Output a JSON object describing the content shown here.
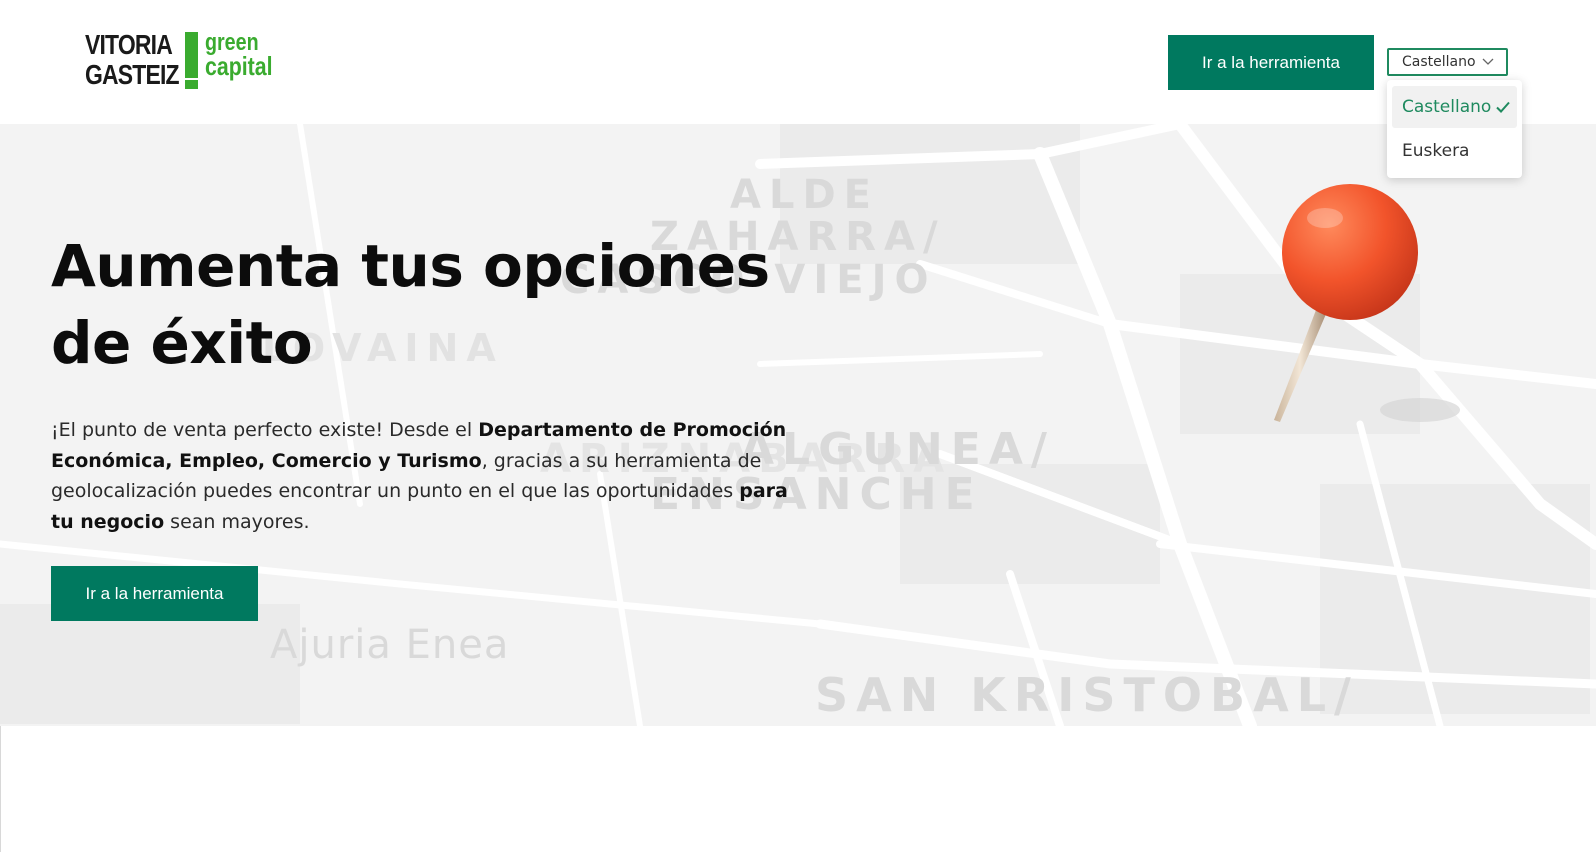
{
  "header": {
    "logo": {
      "line1": "VITORIA",
      "line2": "GASTEIZ",
      "line3": "green",
      "line4": "capital"
    },
    "cta_label": "Ir a la herramienta",
    "language": {
      "selected": "Castellano",
      "options": [
        "Castellano",
        "Euskera"
      ]
    }
  },
  "hero": {
    "title": "Aumenta tus opciones de éxito",
    "paragraph": {
      "p1": "¡El punto de venta perfecto existe! Desde el ",
      "b1": "Departamento de Promoción Económica, Empleo, Comercio y Turismo",
      "p2": ", gracias a su herramienta de geolocalización puedes encontrar un punto en el que las oportunidades ",
      "b2": "para tu negocio",
      "p3": " sean mayores."
    },
    "cta_label": "Ir a la herramienta",
    "map_labels": [
      "ALDE",
      "ZAHARRA/",
      "CASCO VIEJO",
      "LOVAINA",
      "ARIZNABARRA",
      "ALGUNEA/",
      "ENSANCHE",
      "Ajuria Enea",
      "SAN KRISTOBAL/"
    ]
  },
  "colors": {
    "brand_green": "#00795f",
    "logo_green": "#3aab2f",
    "pin_orange": "#f2542b"
  }
}
